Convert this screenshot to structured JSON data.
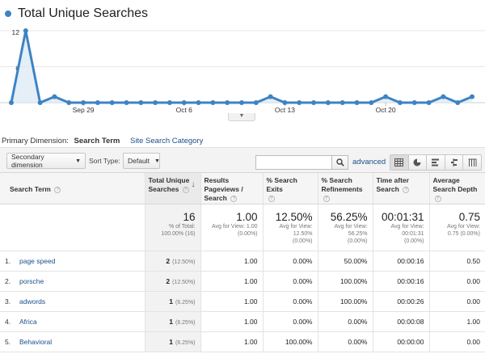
{
  "chart_data": {
    "type": "line",
    "title": "Total Unique Searches",
    "series": [
      {
        "name": "Total Unique Searches",
        "color": "#3d83c4",
        "values": [
          0,
          12,
          0,
          1,
          0,
          0,
          0,
          0,
          0,
          0,
          0,
          0,
          0,
          0,
          0,
          0,
          0,
          0,
          1,
          0,
          0,
          0,
          0,
          0,
          0,
          0,
          1,
          0,
          0,
          0,
          1,
          0,
          1
        ]
      }
    ],
    "x_ticks": [
      {
        "label": "Sep 29",
        "index": 5
      },
      {
        "label": "Oct 6",
        "index": 12
      },
      {
        "label": "Oct 13",
        "index": 19
      },
      {
        "label": "Oct 20",
        "index": 26
      }
    ],
    "y_ticks": [
      6,
      12
    ],
    "ylim": [
      0,
      12
    ]
  },
  "primary_dimension": {
    "label": "Primary Dimension:",
    "current": "Search Term",
    "alternate": "Site Search Category"
  },
  "toolbar": {
    "secondary_dimension": "Secondary dimension",
    "sort_type_label": "Sort Type:",
    "sort_type_value": "Default",
    "advanced": "advanced"
  },
  "table": {
    "headers": {
      "term": "Search Term",
      "total_unique": "Total Unique Searches",
      "results_pageviews": "Results Pageviews / Search",
      "search_exits": "% Search Exits",
      "search_refinements": "% Search Refinements",
      "time_after": "Time after Search",
      "avg_depth": "Average Search Depth"
    },
    "totals": {
      "total_unique": {
        "value": "16",
        "sub1": "% of Total:",
        "sub2": "100.00% (16)"
      },
      "results_pageviews": {
        "value": "1.00",
        "sub1": "Avg for View: 1.00",
        "sub2": "(0.00%)"
      },
      "search_exits": {
        "value": "12.50%",
        "sub1": "Avg for View:",
        "sub2": "12.50%",
        "sub3": "(0.00%)"
      },
      "search_refinements": {
        "value": "56.25%",
        "sub1": "Avg for View:",
        "sub2": "56.25%",
        "sub3": "(0.00%)"
      },
      "time_after": {
        "value": "00:01:31",
        "sub1": "Avg for View:",
        "sub2": "00:01:31",
        "sub3": "(0.00%)"
      },
      "avg_depth": {
        "value": "0.75",
        "sub1": "Avg for View:",
        "sub2": "0.75 (0.00%)"
      }
    },
    "rows": [
      {
        "rank": "1.",
        "term": "page speed",
        "total": "2",
        "pct": "(12.50%)",
        "pageviews": "1.00",
        "exits": "0.00%",
        "refinements": "50.00%",
        "time": "00:00:16",
        "depth": "0.50"
      },
      {
        "rank": "2.",
        "term": "porsche",
        "total": "2",
        "pct": "(12.50%)",
        "pageviews": "1.00",
        "exits": "0.00%",
        "refinements": "100.00%",
        "time": "00:00:16",
        "depth": "0.00"
      },
      {
        "rank": "3.",
        "term": "adwords",
        "total": "1",
        "pct": "(6.25%)",
        "pageviews": "1.00",
        "exits": "0.00%",
        "refinements": "100.00%",
        "time": "00:00:26",
        "depth": "0.00"
      },
      {
        "rank": "4.",
        "term": "Africa",
        "total": "1",
        "pct": "(6.25%)",
        "pageviews": "1.00",
        "exits": "0.00%",
        "refinements": "0.00%",
        "time": "00:00:08",
        "depth": "1.00"
      },
      {
        "rank": "5.",
        "term": "Behavioral",
        "total": "1",
        "pct": "(6.25%)",
        "pageviews": "1.00",
        "exits": "100.00%",
        "refinements": "0.00%",
        "time": "00:00:00",
        "depth": "0.00"
      }
    ]
  }
}
